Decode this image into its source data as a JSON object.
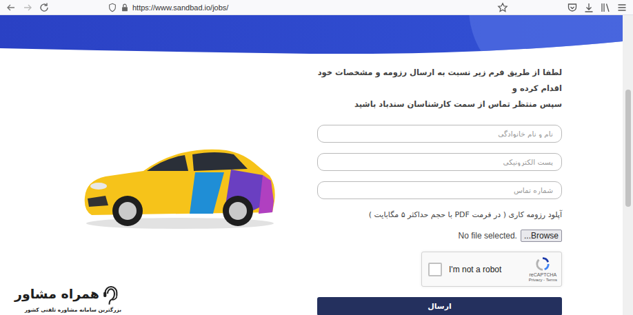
{
  "browser": {
    "url": "https://www.sandbad.io/jobs/"
  },
  "intro": {
    "lines": [
      "لطفا از طریق فرم زیر نسبت به ارسال رزومه و مشخصات خود اقدام کرده و",
      "سپس منتظر تماس از سمت کارشناسان سندباد باشید"
    ]
  },
  "form": {
    "fields": [
      {
        "placeholder": "نام و نام خانوادگی"
      },
      {
        "placeholder": "پست الکترونیکی"
      },
      {
        "placeholder": "شماره تماس"
      }
    ],
    "upload": {
      "label": "آپلود رزومه کاری ( در فرمت PDF با حجم حداکثر ۵ مگابایت )",
      "status": "No file selected.",
      "button": "Browse..."
    },
    "captcha": {
      "label": "I'm not a robot",
      "checked": false,
      "brand": "reCAPTCHA",
      "links": "Privacy - Terms"
    },
    "submit": "ارسال"
  },
  "watermark": {
    "title": "همراه مشاور",
    "subtitle": "بزرگترین سامانه مشاوره تلفنی کشور"
  }
}
